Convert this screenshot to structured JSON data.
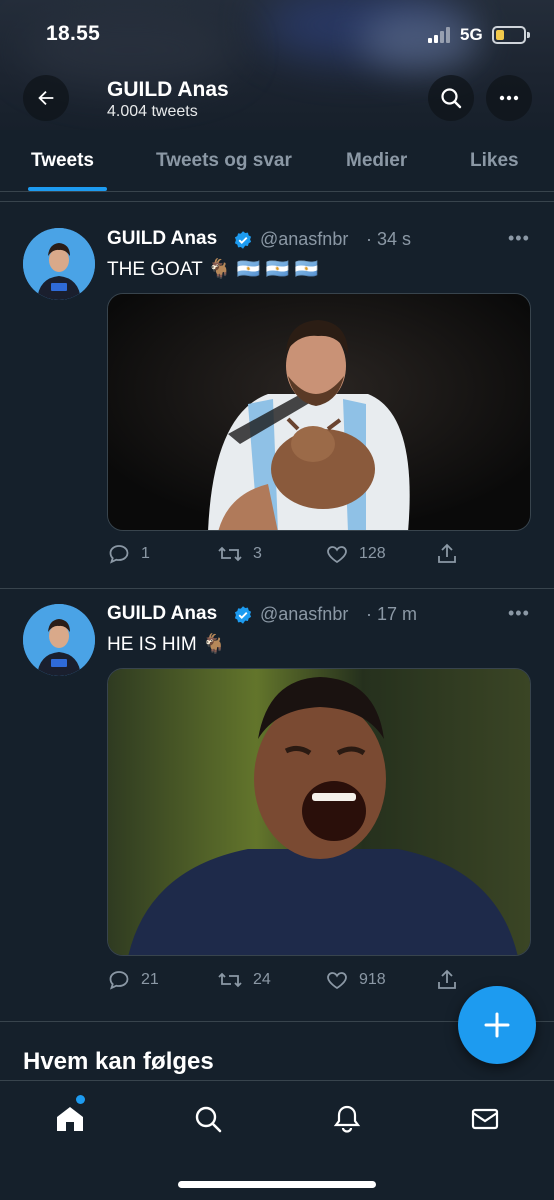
{
  "status_bar": {
    "time": "18.55",
    "network": "5G"
  },
  "header": {
    "title": "GUILD Anas",
    "subtitle": "4.004 tweets"
  },
  "tabs": [
    {
      "label": "Tweets",
      "active": true
    },
    {
      "label": "Tweets og svar",
      "active": false
    },
    {
      "label": "Medier",
      "active": false
    },
    {
      "label": "Likes",
      "active": false
    }
  ],
  "tweets": [
    {
      "name": "GUILD Anas",
      "handle": "@anasfnbr",
      "time": "· 34 s",
      "text": "THE GOAT 🐐 🇦🇷 🇦🇷 🇦🇷",
      "replies": "1",
      "retweets": "3",
      "likes": "128"
    },
    {
      "name": "GUILD Anas",
      "handle": "@anasfnbr",
      "time": "· 17 m",
      "text": "HE IS HIM 🐐",
      "replies": "21",
      "retweets": "24",
      "likes": "918"
    }
  ],
  "section": {
    "who_to_follow": "Hvem kan følges"
  },
  "more_glyph": "•••",
  "colors": {
    "background": "#15202b",
    "accent": "#1d9bf0",
    "muted": "#8b98a5",
    "border": "#38444d"
  },
  "icons": [
    "back-arrow-icon",
    "search-icon",
    "more-icon",
    "verified-badge-icon",
    "reply-icon",
    "retweet-icon",
    "like-icon",
    "share-icon",
    "compose-icon",
    "home-icon",
    "explore-icon",
    "notifications-icon",
    "messages-icon"
  ]
}
